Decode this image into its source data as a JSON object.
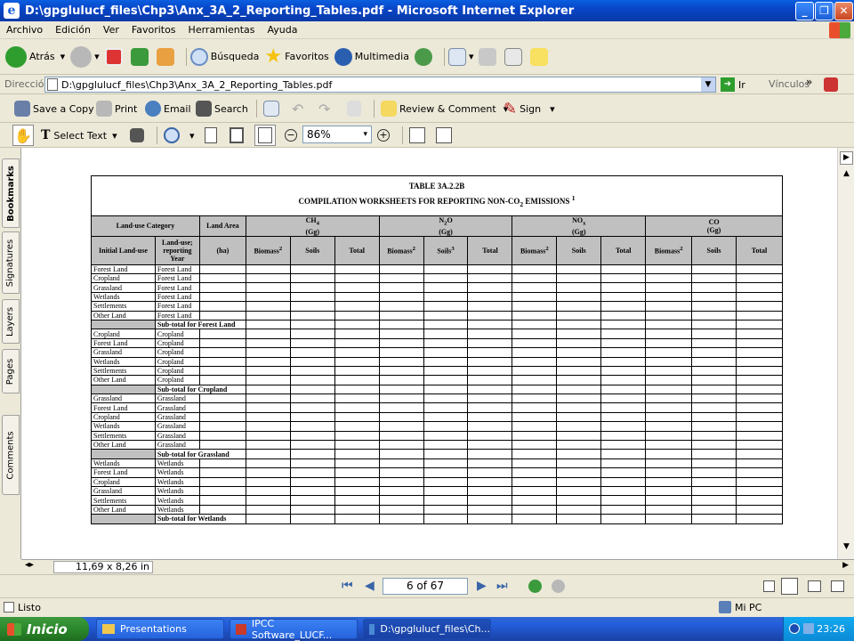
{
  "window": {
    "title": "D:\\gpglulucf_files\\Chp3\\Anx_3A_2_Reporting_Tables.pdf - Microsoft Internet Explorer"
  },
  "menu": [
    "Archivo",
    "Edición",
    "Ver",
    "Favoritos",
    "Herramientas",
    "Ayuda"
  ],
  "toolbar": {
    "back": "Atrás",
    "search": "Búsqueda",
    "favorites": "Favoritos",
    "multimedia": "Multimedia"
  },
  "address": {
    "label": "Dirección",
    "value": "D:\\gpglulucf_files\\Chp3\\Anx_3A_2_Reporting_Tables.pdf",
    "go": "Ir",
    "links": "Vínculos"
  },
  "pdf_toolbar": {
    "save": "Save a Copy",
    "print": "Print",
    "email": "Email",
    "search": "Search",
    "review": "Review & Comment",
    "sign": "Sign",
    "select_text": "Select Text",
    "zoom": "86%"
  },
  "side_tabs": [
    "Bookmarks",
    "Signatures",
    "Layers",
    "Pages",
    "Comments"
  ],
  "page_size": "11,69 x 8,26 in",
  "navigation": {
    "page": "6 of 67"
  },
  "status": {
    "text": "Listo",
    "zone": "Mi PC"
  },
  "taskbar": {
    "start": "Inicio",
    "items": [
      "Presentations",
      "IPCC Software_LUCF...",
      "D:\\gpglulucf_files\\Ch..."
    ],
    "clock": "23:26"
  },
  "table": {
    "title": "TABLE 3A.2.2B",
    "subtitle": "COMPILATION WORKSHEETS FOR REPORTING NON-CO",
    "subtitle_sub": "2",
    "subtitle_end": " EMISSIONS",
    "subtitle_note": "1",
    "headers": {
      "landuse": "Land-use Category",
      "area": "Land Area",
      "ha": "(ha)",
      "initial": "Initial Land-use",
      "reporting": "Land-use; reporting Year",
      "gases": [
        {
          "name": "CH",
          "sub": "4",
          "unit": "(Gg)"
        },
        {
          "name": "N",
          "sub": "2",
          "name2": "O",
          "unit": "(Gg)"
        },
        {
          "name": "NO",
          "sub": "x",
          "unit": "(Gg)"
        },
        {
          "name": "CO",
          "sub": "",
          "unit": "(Gg)"
        }
      ],
      "cols": [
        "Biomass",
        "Soils",
        "Total"
      ],
      "col_notes": {
        "biomass": "2",
        "soils_n2o": "3"
      }
    },
    "groups": [
      {
        "rows": [
          [
            "Forest Land",
            "Forest Land"
          ],
          [
            "Cropland",
            "Forest Land"
          ],
          [
            "Grassland",
            "Forest Land"
          ],
          [
            "Wetlands",
            "Forest Land"
          ],
          [
            "Settlements",
            "Forest Land"
          ],
          [
            "Other Land",
            "Forest Land"
          ]
        ],
        "subtotal": "Sub-total for Forest Land"
      },
      {
        "rows": [
          [
            "Cropland",
            "Cropland"
          ],
          [
            "Forest Land",
            "Cropland"
          ],
          [
            "Grassland",
            "Cropland"
          ],
          [
            "Wetlands",
            "Cropland"
          ],
          [
            "Settlements",
            "Cropland"
          ],
          [
            "Other Land",
            "Cropland"
          ]
        ],
        "subtotal": "Sub-total for Cropland"
      },
      {
        "rows": [
          [
            "Grassland",
            "Grassland"
          ],
          [
            "Forest Land",
            "Grassland"
          ],
          [
            "Cropland",
            "Grassland"
          ],
          [
            "Wetlands",
            "Grassland"
          ],
          [
            "Settlements",
            "Grassland"
          ],
          [
            "Other Land",
            "Grassland"
          ]
        ],
        "subtotal": "Sub-total for Grassland"
      },
      {
        "rows": [
          [
            "Wetlands",
            "Wetlands"
          ],
          [
            "Forest Land",
            "Wetlands"
          ],
          [
            "Cropland",
            "Wetlands"
          ],
          [
            "Grassland",
            "Wetlands"
          ],
          [
            "Settlements",
            "Wetlands"
          ],
          [
            "Other Land",
            "Wetlands"
          ]
        ],
        "subtotal": "Sub-total for Wetlands"
      }
    ]
  }
}
